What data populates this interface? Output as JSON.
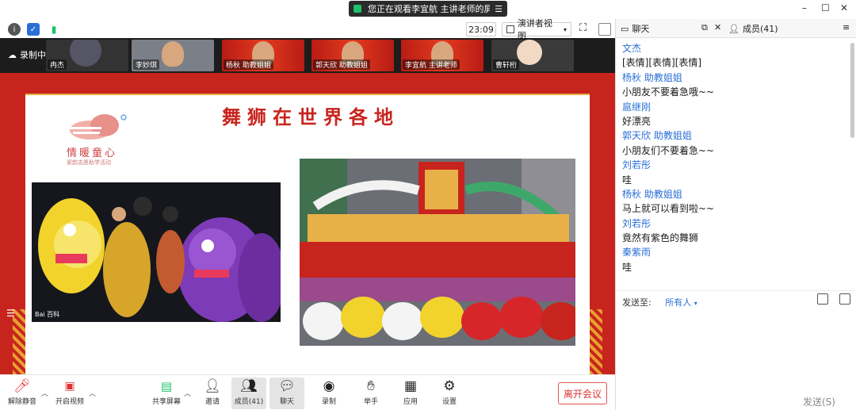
{
  "titlebar": {
    "share_notice": "您正在观看李宜航 主讲老师的屏幕",
    "minimize": "–",
    "maximize": "☐",
    "close": "✕"
  },
  "toolbar": {
    "time": "23:09",
    "view_mode": "演讲者视图"
  },
  "video": {
    "recording_label": "录制中",
    "thumbnails": [
      {
        "name": "冉杰"
      },
      {
        "name": "李妙琪"
      },
      {
        "name": "杨秋 助教姐姐"
      },
      {
        "name": "郭天欣 助教姐姐"
      },
      {
        "name": "李宜航 主讲老师"
      },
      {
        "name": "曹轩桁"
      }
    ]
  },
  "slide": {
    "title": "舞狮在世界各地",
    "logo_name": "情暖童心",
    "logo_sub": "紧韵志愿助学活动",
    "watermark": "Bai 百科"
  },
  "bottombar": {
    "mute": "解除静音",
    "video": "开启视频",
    "share": "共享屏幕",
    "invite": "邀请",
    "members": "成员(41)",
    "chat": "聊天",
    "record": "录制",
    "raise_hand": "举手",
    "apps": "应用",
    "settings": "设置",
    "leave": "离开会议"
  },
  "panel": {
    "chat_tab": "聊天",
    "members_tab": "成员(41)",
    "messages": [
      {
        "sender": "文杰",
        "text": "[表情][表情][表情]"
      },
      {
        "sender": "杨秋  助教姐姐",
        "text": "小朋友不要着急哦~~"
      },
      {
        "sender": "扈继刚",
        "text": "好漂亮"
      },
      {
        "sender": " 郭天欣  助教姐姐",
        "text": "小朋友们不要着急~~"
      },
      {
        "sender": "刘若彤",
        "text": "哇"
      },
      {
        "sender": "杨秋  助教姐姐",
        "text": "马上就可以看到啦~~"
      },
      {
        "sender": "刘若彤",
        "text": "竟然有紫色的舞狮"
      },
      {
        "sender": "秦紫雨",
        "text": "哇"
      }
    ],
    "send_to_label": "发送至:",
    "send_to_value": "所有人",
    "send_button": "发送(S)"
  },
  "colors": {
    "accent": "#2a6fd6",
    "slide_red": "#c8241e",
    "leave_red": "#d33333"
  }
}
